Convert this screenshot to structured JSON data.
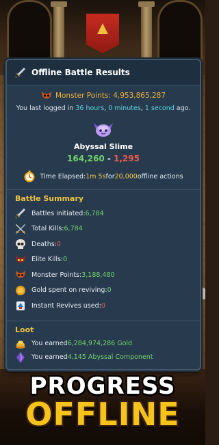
{
  "panel": {
    "title": "Offline Battle Results",
    "monster_points_label": "Monster Points: 4,953,865,287",
    "login": {
      "prefix": "You last logged in ",
      "hours": "36 hours",
      "sep1": ", ",
      "minutes": "0 minutes",
      "sep2": ", ",
      "seconds": "1 second",
      "suffix": " ago."
    },
    "monster_name": "Abyssal Slime",
    "score_green": "164,260",
    "score_sep": " - ",
    "score_red": "1,295",
    "time": {
      "prefix": "Time Elapsed: ",
      "elapsed": "1m 5s",
      "mid": " for ",
      "actions": "20,000",
      "suffix": " offline actions"
    }
  },
  "battle_summary": {
    "title": "Battle Summary",
    "items": [
      {
        "label": "Battles initiated: ",
        "value": "6,784",
        "icon": "sword-icon"
      },
      {
        "label": "Total Kills: ",
        "value": "6,784",
        "icon": "crossed-swords-icon"
      },
      {
        "label": "Deaths: ",
        "value": "0",
        "icon": "skull-icon"
      },
      {
        "label": "Elite Kills: ",
        "value": "0",
        "icon": "elite-demon-icon"
      },
      {
        "label": "Monster Points: ",
        "value": "3,188,480",
        "icon": "monster-mask-icon"
      },
      {
        "label": "Gold spent on reviving: ",
        "value": "0",
        "icon": "gold-coin-icon"
      },
      {
        "label": "Instant Revives used: ",
        "value": "0",
        "icon": "revive-potion-icon"
      }
    ]
  },
  "loot": {
    "title": "Loot",
    "items": [
      {
        "prefix": "You earned ",
        "value": "6,284,974,286 Gold",
        "icon": "gold-pile-icon"
      },
      {
        "prefix": "You earned ",
        "value": "4,145 Abyssal Component",
        "icon": "abyssal-crystal-icon"
      }
    ]
  },
  "promo": {
    "line1": "PROGRESS",
    "line2": "OFFLINE"
  },
  "colors": {
    "panel_bg": "#283b4e",
    "accent_gold": "#f0c23f",
    "value_green": "#6fd26a",
    "value_red": "#ec5a4c",
    "value_cyan": "#5ad5e3"
  }
}
